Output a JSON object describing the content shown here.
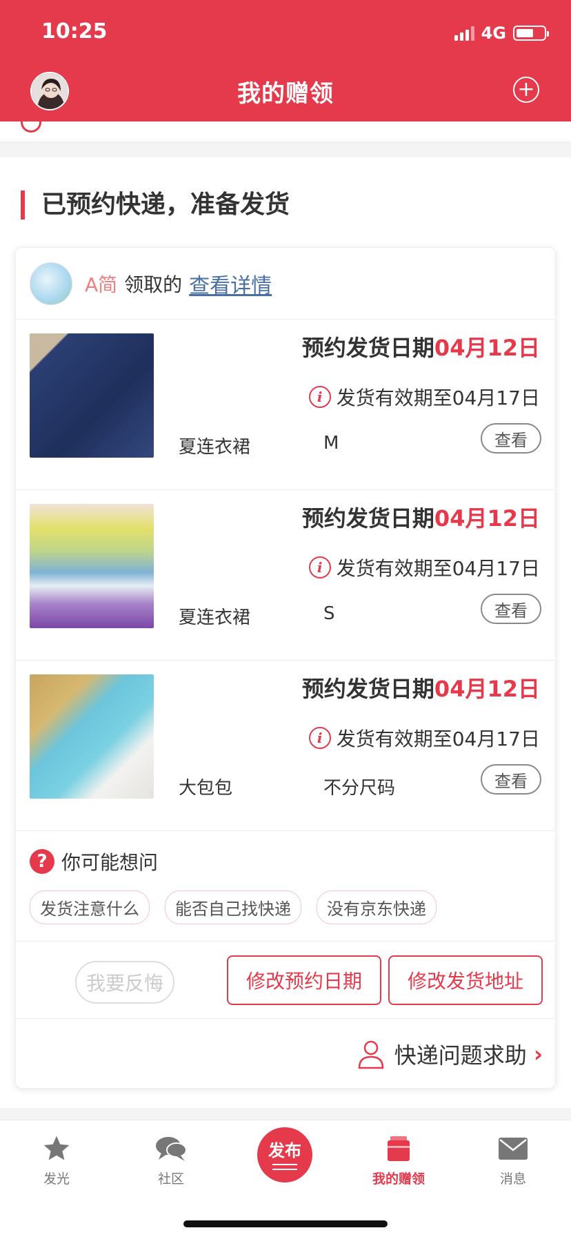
{
  "status_bar": {
    "time": "10:25",
    "network": "4G"
  },
  "header": {
    "title": "我的赠领",
    "add_icon": "plus-circle-icon"
  },
  "section": {
    "title": "已预约快递，准备发货"
  },
  "card": {
    "giver_name": "A简",
    "action_text": "领取的",
    "detail_link": "查看详情",
    "items": [
      {
        "date_label": "预约发货日期",
        "date_value": "04月12日",
        "valid_text": "发货有效期至04月17日",
        "name": "夏连衣裙",
        "size": "M",
        "view_label": "查看"
      },
      {
        "date_label": "预约发货日期",
        "date_value": "04月12日",
        "valid_text": "发货有效期至04月17日",
        "name": "夏连衣裙",
        "size": "S",
        "view_label": "查看"
      },
      {
        "date_label": "预约发货日期",
        "date_value": "04月12日",
        "valid_text": "发货有效期至04月17日",
        "name": "大包包",
        "size": "不分尺码",
        "view_label": "查看"
      }
    ],
    "faq": {
      "title": "你可能想问",
      "tags": [
        "发货注意什么",
        "能否自己找快递",
        "没有京东快递"
      ]
    },
    "actions": {
      "regret": "我要反悔",
      "modify_date": "修改预约日期",
      "modify_address": "修改发货地址"
    },
    "help": {
      "label": "快递问题求助"
    }
  },
  "tabbar": {
    "tabs": [
      {
        "label": "发光",
        "icon": "star-icon"
      },
      {
        "label": "社区",
        "icon": "chat-bubbles-icon"
      },
      {
        "label": "发布",
        "icon": "publish-icon"
      },
      {
        "label": "我的赠领",
        "icon": "gift-box-icon",
        "active": true
      },
      {
        "label": "消息",
        "icon": "envelope-icon"
      }
    ]
  },
  "colors": {
    "brand": "#e5394c",
    "link": "#4a6fa5",
    "accent_soft": "#f08080"
  }
}
